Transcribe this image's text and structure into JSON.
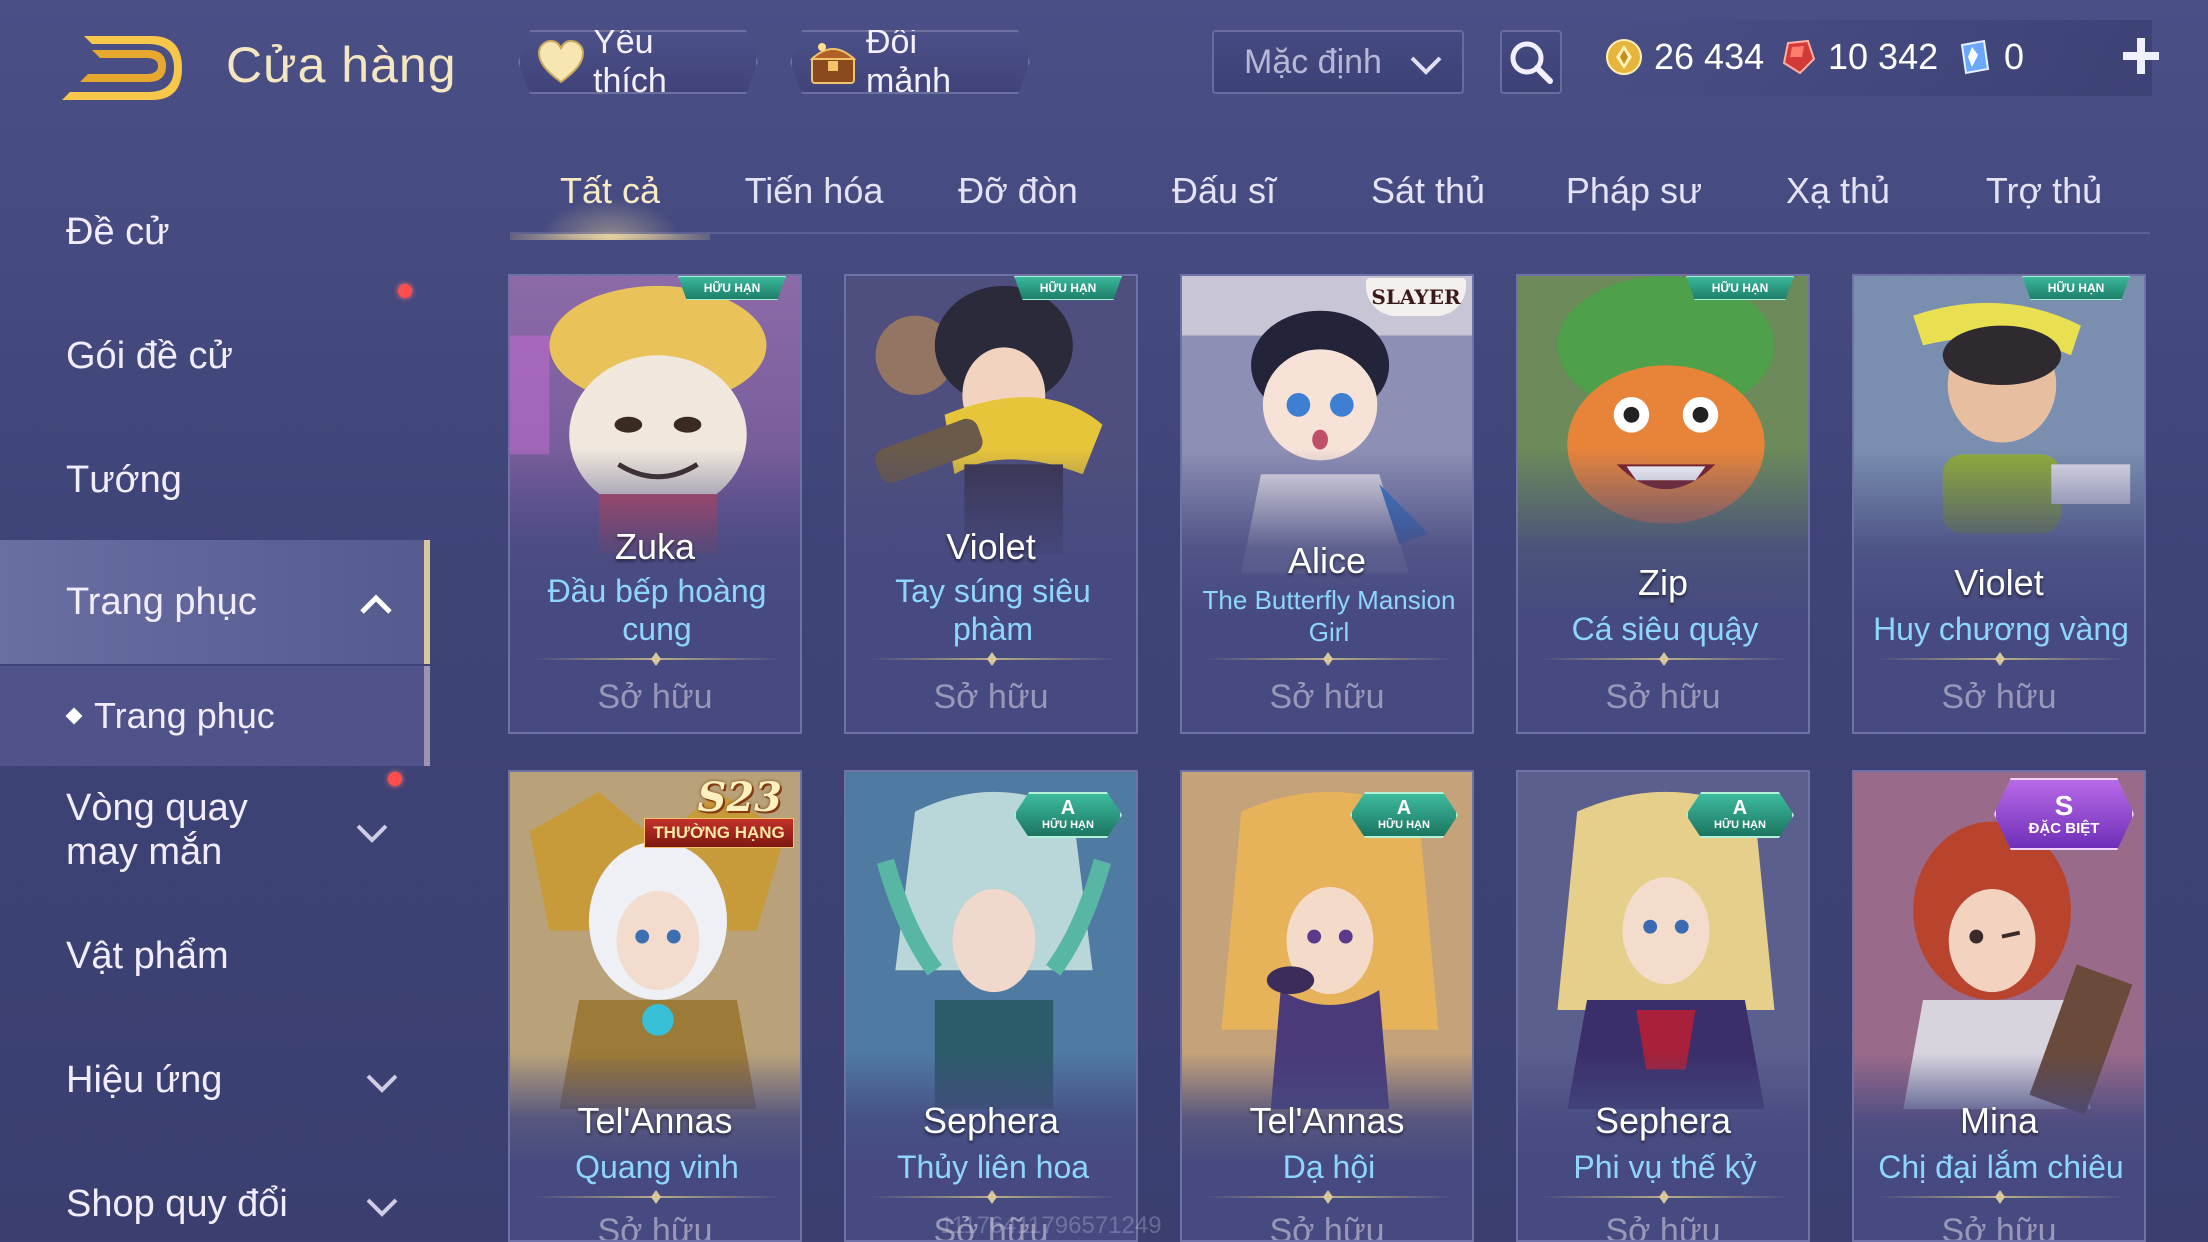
{
  "header": {
    "title": "Cửa hàng",
    "favorites_label": "Yêu thích",
    "exchange_shards_label": "Đổi mảnh",
    "sort_value": "Mặc định"
  },
  "currencies": {
    "gold": "26 434",
    "ruby": "10 342",
    "voucher": "0"
  },
  "sidebar": {
    "items": [
      {
        "label": "Đề cử"
      },
      {
        "label": "Gói đề cử",
        "notification": true
      },
      {
        "label": "Tướng"
      },
      {
        "label": "Trang phục",
        "expanded": true,
        "active": true
      },
      {
        "label": "Trang phục",
        "sub": true
      },
      {
        "label": "Vòng quay may mắn",
        "notification": true
      },
      {
        "label": "Vật phẩm"
      },
      {
        "label": "Hiệu ứng"
      },
      {
        "label": "Shop quy đổi"
      }
    ]
  },
  "tabs": [
    {
      "label": "Tất cả",
      "active": true
    },
    {
      "label": "Tiến hóa"
    },
    {
      "label": "Đỡ đòn"
    },
    {
      "label": "Đấu sĩ"
    },
    {
      "label": "Sát thủ"
    },
    {
      "label": "Pháp sư"
    },
    {
      "label": "Xạ thủ"
    },
    {
      "label": "Trợ thủ"
    }
  ],
  "badges": {
    "limited": "HỮU HẠN",
    "a_grade": "A",
    "slayer": "SLAYER",
    "s23": "S23",
    "s23_rank": "THƯỜNG HẠNG",
    "special_grade": "S",
    "special": "ĐẶC BIỆT"
  },
  "cards": [
    {
      "hero": "Zuka",
      "skin": "Đầu bếp hoàng cung",
      "status": "Sở hữu",
      "badge": "limited"
    },
    {
      "hero": "Violet",
      "skin": "Tay súng siêu phàm",
      "status": "Sở hữu",
      "badge": "limited"
    },
    {
      "hero": "Alice",
      "skin": "The Butterfly Mansion Girl",
      "status": "Sở hữu",
      "badge": "slayer"
    },
    {
      "hero": "Zip",
      "skin": "Cá siêu quậy",
      "status": "Sở hữu",
      "badge": "limited"
    },
    {
      "hero": "Violet",
      "skin": "Huy chương vàng",
      "status": "Sở hữu",
      "badge": "limited"
    },
    {
      "hero": "Tel'Annas",
      "skin": "Quang vinh",
      "status": "Sở hữu",
      "badge": "s23"
    },
    {
      "hero": "Sephera",
      "skin": "Thủy liên hoa",
      "status": "Sở hữu",
      "badge": "a"
    },
    {
      "hero": "Tel'Annas",
      "skin": "Dạ hội",
      "status": "Sở hữu",
      "badge": "a"
    },
    {
      "hero": "Sephera",
      "skin": "Phi vụ thế kỷ",
      "status": "Sở hữu",
      "badge": "a"
    },
    {
      "hero": "Mina",
      "skin": "Chị đại lắm chiêu",
      "status": "Sở hữu",
      "badge": "special"
    }
  ],
  "watermark": "11176411796571249",
  "colors": {
    "background": "#434880",
    "title_gold": "#f3e6c0",
    "skin_name_blue": "#8fd6ff",
    "owned_gray": "#9a98b8",
    "notification_red": "#ff4d4d",
    "limited_badge_green": "#2a9c82",
    "special_badge_purple": "#8e45cf"
  },
  "icons": {
    "back": "back-arrow-icon",
    "favorite": "heart-icon",
    "shards": "chest-icon",
    "sort": "chevron-down-icon",
    "search": "search-icon",
    "gold": "gold-coin-icon",
    "ruby": "ruby-gem-icon",
    "voucher": "voucher-icon",
    "add": "plus-icon"
  }
}
